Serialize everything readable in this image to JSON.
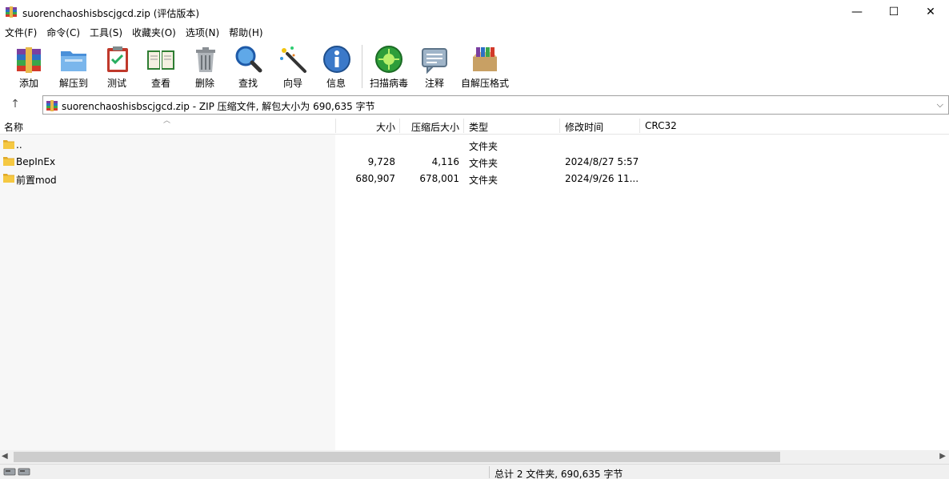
{
  "window": {
    "title": "suorenchaoshisbscjgcd.zip (评估版本)",
    "minimize_glyph": "—",
    "maximize_glyph": "☐",
    "close_glyph": "✕"
  },
  "menu": [
    "文件(F)",
    "命令(C)",
    "工具(S)",
    "收藏夹(O)",
    "选项(N)",
    "帮助(H)"
  ],
  "toolbar": {
    "add": "添加",
    "extract": "解压到",
    "test": "测试",
    "view": "查看",
    "delete": "删除",
    "find": "查找",
    "wizard": "向导",
    "info": "信息",
    "virus_scan": "扫描病毒",
    "comment": "注释",
    "sfx": "自解压格式"
  },
  "address": {
    "up_glyph": "↑",
    "text": "suorenchaoshisbscjgcd.zip - ZIP 压缩文件, 解包大小为 690,635 字节",
    "dropdown_glyph": "⌵"
  },
  "columns": {
    "name": "名称",
    "size": "大小",
    "packed": "压缩后大小",
    "type": "类型",
    "modified": "修改时间",
    "crc": "CRC32"
  },
  "files": [
    {
      "name": "..",
      "size": "",
      "packed": "",
      "type": "文件夹",
      "modified": "",
      "crc": ""
    },
    {
      "name": "BepInEx",
      "size": "9,728",
      "packed": "4,116",
      "type": "文件夹",
      "modified": "2024/8/27 5:57",
      "crc": ""
    },
    {
      "name": "前置mod",
      "size": "680,907",
      "packed": "678,001",
      "type": "文件夹",
      "modified": "2024/9/26 11...",
      "crc": ""
    }
  ],
  "status": {
    "text": "总计 2 文件夹, 690,635 字节"
  },
  "colors": {
    "left_pane": "#f7f7f7",
    "folder": "#f5c842",
    "scrollbar_thumb": "#cdcdcd"
  }
}
